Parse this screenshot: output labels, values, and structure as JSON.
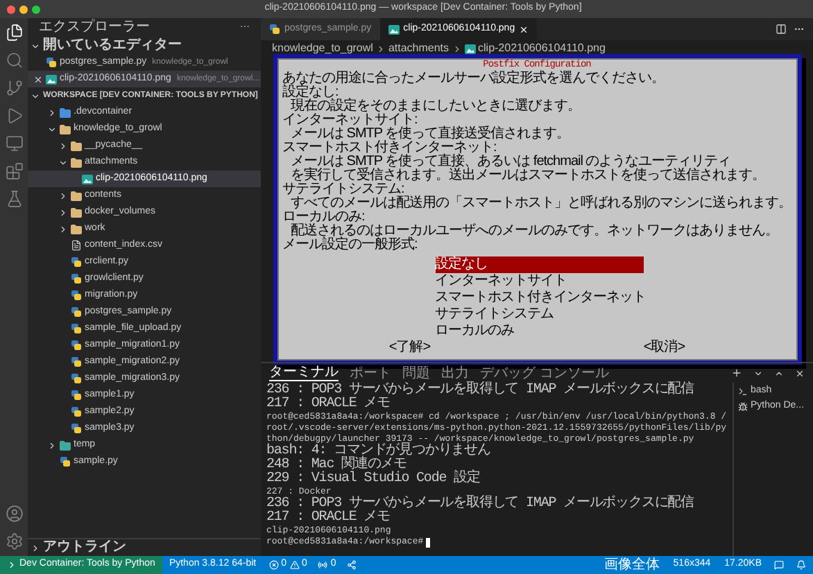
{
  "window": {
    "title": "clip-20210606104110.png — workspace [Dev Container: Tools by Python]"
  },
  "activity_bar": {
    "top": [
      {
        "kind": "explorer",
        "selected": true
      },
      {
        "kind": "search",
        "selected": false
      },
      {
        "kind": "source-control",
        "selected": false
      },
      {
        "kind": "run-debug",
        "selected": false
      },
      {
        "kind": "remote",
        "selected": false
      },
      {
        "kind": "extensions",
        "selected": false
      },
      {
        "kind": "testing",
        "selected": false
      }
    ],
    "bottom": [
      {
        "kind": "accounts",
        "selected": false
      },
      {
        "kind": "settings",
        "selected": false
      }
    ]
  },
  "explorer": {
    "title": "エクスプローラー",
    "more": "···",
    "open_editors": {
      "title": "開いているエディター",
      "expanded": true,
      "items": [
        {
          "name": "postgres_sample.py",
          "description": "knowledge_to_growl",
          "kind": "python",
          "selected": false
        },
        {
          "name": "clip-20210606104110.png",
          "description": "knowledge_to_growl...",
          "kind": "image",
          "selected": true
        }
      ]
    },
    "workspace": {
      "title": "WORKSPACE [DEV CONTAINER: TOOLS BY PYTHON]",
      "expanded": true,
      "items": [
        {
          "name": ".devcontainer",
          "kind": "devcontainer",
          "expanded": false,
          "selected": false
        },
        {
          "name": "knowledge_to_growl",
          "kind": "folder",
          "expanded": true,
          "selected": false,
          "children": [
            {
              "name": "__pycache__",
              "kind": "folder",
              "expanded": false,
              "selected": false
            },
            {
              "name": "attachments",
              "kind": "folder",
              "expanded": true,
              "selected": false,
              "children": [
                {
                  "name": "clip-20210606104110.png",
                  "kind": "image",
                  "selected": true
                }
              ]
            },
            {
              "name": "contents",
              "kind": "folder",
              "expanded": false,
              "selected": false
            },
            {
              "name": "docker_volumes",
              "kind": "folder",
              "expanded": false,
              "selected": false
            },
            {
              "name": "work",
              "kind": "folder",
              "expanded": false,
              "selected": false
            },
            {
              "name": "content_index.csv",
              "kind": "file",
              "selected": false
            },
            {
              "name": "crclient.py",
              "kind": "python",
              "selected": false
            },
            {
              "name": "growlclient.py",
              "kind": "python",
              "selected": false
            },
            {
              "name": "migration.py",
              "kind": "python",
              "selected": false
            },
            {
              "name": "postgres_sample.py",
              "kind": "python",
              "selected": false
            },
            {
              "name": "sample_file_upload.py",
              "kind": "python",
              "selected": false
            },
            {
              "name": "sample_migration1.py",
              "kind": "python",
              "selected": false
            },
            {
              "name": "sample_migration2.py",
              "kind": "python",
              "selected": false
            },
            {
              "name": "sample_migration3.py",
              "kind": "python",
              "selected": false
            },
            {
              "name": "sample1.py",
              "kind": "python",
              "selected": false
            },
            {
              "name": "sample2.py",
              "kind": "python",
              "selected": false
            },
            {
              "name": "sample3.py",
              "kind": "python",
              "selected": false
            }
          ]
        },
        {
          "name": "temp",
          "kind": "temp",
          "expanded": false,
          "selected": false
        },
        {
          "name": "sample.py",
          "kind": "python",
          "selected": false
        }
      ]
    },
    "outline": {
      "title": "アウトライン",
      "expanded": false
    }
  },
  "tabs": [
    {
      "label": "postgres_sample.py",
      "kind": "python",
      "selected": false
    },
    {
      "label": "clip-20210606104110.png",
      "kind": "image",
      "selected": true
    }
  ],
  "breadcrumb": [
    "knowledge_to_growl",
    "attachments",
    "clip-20210606104110.png"
  ],
  "dialog": {
    "title": "Postfix Configuration",
    "lines": [
      {
        "text": "あなたの用途に合ったメールサーバ設定形式を選んでください。",
        "indented": false
      },
      {
        "text": "設定なし:",
        "indented": false
      },
      {
        "text": "現在の設定をそのままにしたいときに選びます。",
        "indented": true
      },
      {
        "text": "インターネットサイト:",
        "indented": false
      },
      {
        "text": "メールは SMTP を使って直接送受信されます。",
        "indented": true
      },
      {
        "text": "スマートホスト付きインターネット:",
        "indented": false
      },
      {
        "text": "メールは SMTP を使って直接、あるいは fetchmail のようなユーティリティ",
        "indented": true
      },
      {
        "text": "を実行して受信されます。送出メールはスマートホストを使って送信されます。",
        "indented": true
      },
      {
        "text": "サテライトシステム:",
        "indented": false
      },
      {
        "text": "すべてのメールは配送用の「スマートホスト」と呼ばれる別のマシンに送られます。",
        "indented": true
      },
      {
        "text": "ローカルのみ:",
        "indented": false
      },
      {
        "text": "配送されるのはローカルユーザへのメールのみです。ネットワークはありません。",
        "indented": true
      },
      {
        "text": "メール設定の一般形式:",
        "indented": false
      }
    ],
    "options": [
      {
        "label": "設定なし",
        "selected": true
      },
      {
        "label": "インターネットサイト",
        "selected": false
      },
      {
        "label": "スマートホスト付きインターネット",
        "selected": false
      },
      {
        "label": "サテライトシステム",
        "selected": false
      },
      {
        "label": "ローカルのみ",
        "selected": false
      }
    ],
    "buttons": [
      "<了解>",
      "<取消>"
    ]
  },
  "panel": {
    "tabs": [
      {
        "label": "ターミナル",
        "selected": true
      },
      {
        "label": "ポート",
        "selected": false
      },
      {
        "label": "問題",
        "selected": false
      },
      {
        "label": "出力",
        "selected": false
      },
      {
        "label": "デバッグ コンソール",
        "selected": false
      }
    ],
    "terminal": {
      "lines": [
        "236 : POP3 サーバからメールを取得して IMAP メールボックスに配信",
        "217 : ORACLE メモ",
        "root@ced5831a8a4a:/workspace# cd /workspace ; /usr/bin/env /usr/local/bin/python3.8 /root/.vscode-server/extensions/ms-python.python-2021.12.1559732655/pythonFiles/lib/python/debugpy/launcher 39173 -- /workspace/knowledge_to_growl/postgres_sample.py",
        "bash: 4: コマンドが見つかりません",
        "248 : Mac 関連のメモ",
        "229 : Visual Studio Code 設定",
        "227 : Docker",
        "236 : POP3 サーバからメールを取得して IMAP メールボックスに配信",
        "217 : ORACLE メモ",
        "clip-20210606104110.png"
      ],
      "prompt": "root@ced5831a8a4a:/workspace#"
    },
    "sessions": [
      {
        "label": "bash",
        "kind": "shell"
      },
      {
        "label": "Python De...",
        "kind": "debug"
      }
    ]
  },
  "status_bar": {
    "remote": "Dev Container: Tools by Python",
    "interpreter": "Python 3.8.12 64-bit",
    "errors": "0",
    "warnings": "0",
    "ports": "0",
    "zoom": "画像全体",
    "dimensions": "516x344",
    "size": "17.20KB"
  }
}
